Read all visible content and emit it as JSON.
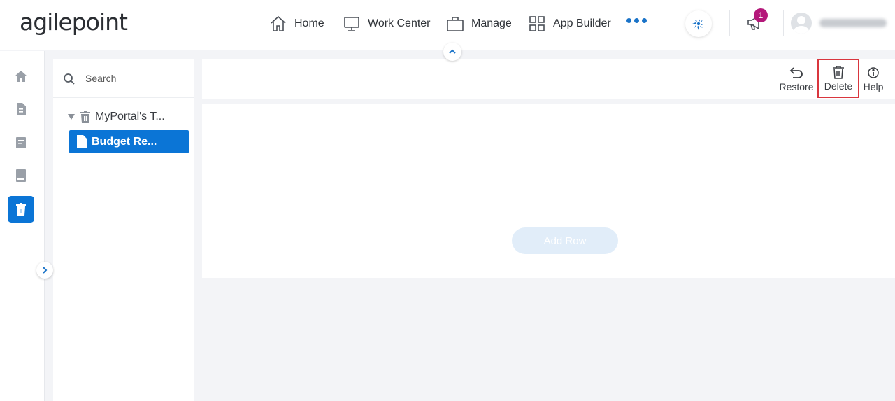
{
  "header": {
    "logo_text": "agilepoint",
    "nav": [
      {
        "label": "Home",
        "icon": "home-icon"
      },
      {
        "label": "Work Center",
        "icon": "monitor-icon"
      },
      {
        "label": "Manage",
        "icon": "briefcase-icon"
      },
      {
        "label": "App Builder",
        "icon": "grid-icon"
      }
    ],
    "more_icon": "more-dots-icon",
    "notification_count": "1",
    "user_name_blurred": true
  },
  "rail": {
    "items": [
      {
        "icon": "home-icon",
        "active": false
      },
      {
        "icon": "document-icon",
        "active": false
      },
      {
        "icon": "form-icon",
        "active": false
      },
      {
        "icon": "book-icon",
        "active": false
      },
      {
        "icon": "trash-icon",
        "active": true
      }
    ]
  },
  "tree": {
    "search_placeholder": "Search",
    "root_label": "MyPortal's T...",
    "child_label": "Budget Re..."
  },
  "toolbar": {
    "restore_label": "Restore",
    "delete_label": "Delete",
    "help_label": "Help"
  },
  "content": {
    "add_row_label": "Add Row"
  },
  "colors": {
    "accent": "#0b75d6",
    "badge": "#b4187a",
    "highlight_border": "#d9363e"
  }
}
